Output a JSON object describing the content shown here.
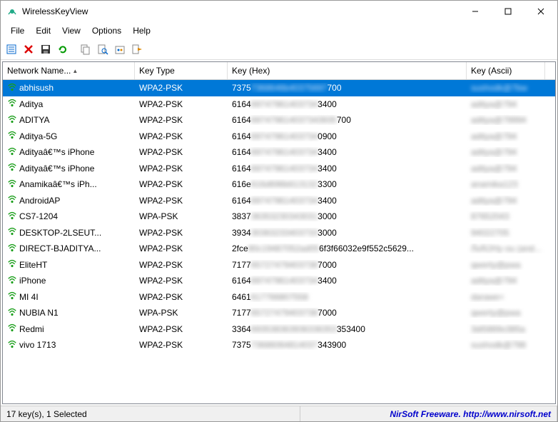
{
  "window": {
    "title": "WirelessKeyView",
    "min": "–",
    "max": "☐",
    "close": "✕"
  },
  "menu": {
    "file": "File",
    "edit": "Edit",
    "view": "View",
    "options": "Options",
    "help": "Help"
  },
  "columns": {
    "name": "Network Name...",
    "type": "Key Type",
    "hex": "Key (Hex)",
    "ascii": "Key (Ascii)"
  },
  "rows": [
    {
      "name": "abhisush",
      "type": "WPA2-PSK",
      "hex_vis": "7375",
      "hex_blur": "7368646b40375697",
      "hex_tail": "700",
      "ascii": "sushodk@7bw",
      "selected": true
    },
    {
      "name": "Aditya",
      "type": "WPA2-PSK",
      "hex_vis": "6164",
      "hex_blur": "69747961403734",
      "hex_tail": "3400",
      "ascii": "aditya@794"
    },
    {
      "name": "ADITYA",
      "type": "WPA2-PSK",
      "hex_vis": "6164",
      "hex_blur": "697479614037343935",
      "hex_tail": "700",
      "ascii": "aditya@79994"
    },
    {
      "name": "Aditya-5G",
      "type": "WPA2-PSK",
      "hex_vis": "6164",
      "hex_blur": "69747961403734",
      "hex_tail": "0900",
      "ascii": "aditya@794"
    },
    {
      "name": "Adityaâ€™s iPhone",
      "type": "WPA2-PSK",
      "hex_vis": "6164",
      "hex_blur": "69747961403734",
      "hex_tail": "3400",
      "ascii": "aditya@794"
    },
    {
      "name": "Adityaâ€™s iPhone",
      "type": "WPA2-PSK",
      "hex_vis": "6164",
      "hex_blur": "69747961403734",
      "hex_tail": "3400",
      "ascii": "aditya@794"
    },
    {
      "name": "Anamikaâ€™s iPh...",
      "type": "WPA2-PSK",
      "hex_vis": "616e",
      "hex_blur": "616d696b613132",
      "hex_tail": "3300",
      "ascii": "anamika123"
    },
    {
      "name": "AndroidAP",
      "type": "WPA2-PSK",
      "hex_vis": "6164",
      "hex_blur": "69747961403734",
      "hex_tail": "3400",
      "ascii": "aditya@794"
    },
    {
      "name": "CS7-1204",
      "type": "WPA-PSK",
      "hex_vis": "3837",
      "hex_blur": "36353230343031",
      "hex_tail": "3000",
      "ascii": "87652043"
    },
    {
      "name": "DESKTOP-2LSEUT...",
      "type": "WPA2-PSK",
      "hex_vis": "3934",
      "hex_blur": "30363233403733",
      "hex_tail": "3000",
      "ascii": "94022705"
    },
    {
      "name": "DIRECT-BJADITYA...",
      "type": "WPA2-PSK",
      "hex_vis": "2fce",
      "hex_blur": "80c19487052ad05",
      "hex_tail": "6f3f66032e9f552c5629...",
      "ascii": "/ÎxÀÙHy·ou (and..."
    },
    {
      "name": "EliteHT",
      "type": "WPA2-PSK",
      "hex_vis": "7177",
      "hex_blur": "65727479403738",
      "hex_tail": "7000",
      "ascii": "qwerty@pwa"
    },
    {
      "name": "iPhone",
      "type": "WPA2-PSK",
      "hex_vis": "6164",
      "hex_blur": "69747961403734",
      "hex_tail": "3400",
      "ascii": "aditya@794"
    },
    {
      "name": "MI 4I",
      "type": "WPA2-PSK",
      "hex_vis": "6461",
      "hex_blur": "617766807558",
      "hex_tail": "",
      "ascii": "darawe="
    },
    {
      "name": "NUBIA N1",
      "type": "WPA-PSK",
      "hex_vis": "7177",
      "hex_blur": "65727479403738",
      "hex_tail": "7000",
      "ascii": "qwerty@pwa"
    },
    {
      "name": "Redmi",
      "type": "WPA2-PSK",
      "hex_vis": "3364",
      "hex_blur": "693538363936336353",
      "hex_tail": "353400",
      "ascii": "3di5869o385a"
    },
    {
      "name": "vivo 1713",
      "type": "WPA2-PSK",
      "hex_vis": "7375",
      "hex_blur": "73686064814037",
      "hex_tail": "343900",
      "ascii": "sushodk@798"
    }
  ],
  "status": {
    "left": "17 key(s), 1 Selected",
    "right": "NirSoft Freeware.  http://www.nirsoft.net"
  }
}
